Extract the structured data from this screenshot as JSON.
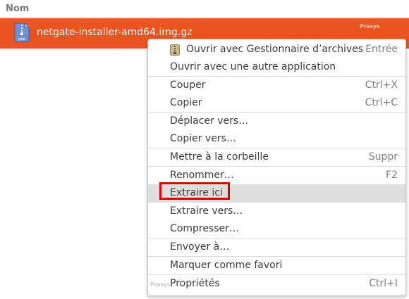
{
  "column_header": {
    "name_label": "Nom"
  },
  "file": {
    "name": "netgate-installer-amd64.img.gz",
    "icon": "gzip-archive-icon",
    "icon_caption": "gzip",
    "selected_color": "#e95420"
  },
  "watermark": "Prasys",
  "context_menu": {
    "items": [
      {
        "label": "Ouvrir avec Gestionnaire d’archives",
        "shortcut": "Entrée",
        "icon": "archive-manager-icon"
      },
      {
        "label": "Ouvrir avec une autre application",
        "shortcut": ""
      },
      {
        "label": "Couper",
        "shortcut": "Ctrl+X"
      },
      {
        "label": "Copier",
        "shortcut": "Ctrl+C"
      },
      {
        "label": "Déplacer vers…",
        "shortcut": ""
      },
      {
        "label": "Copier vers…",
        "shortcut": ""
      },
      {
        "label": "Mettre à la corbeille",
        "shortcut": "Suppr"
      },
      {
        "label": "Renommer…",
        "shortcut": "F2"
      },
      {
        "label": "Extraire ici",
        "shortcut": "",
        "highlighted": true
      },
      {
        "label": "Extraire vers…",
        "shortcut": ""
      },
      {
        "label": "Compresser…",
        "shortcut": ""
      },
      {
        "label": "Envoyer à…",
        "shortcut": ""
      },
      {
        "label": "Marquer comme favori",
        "shortcut": ""
      },
      {
        "label": "Propriétés",
        "shortcut": "Ctrl+I"
      }
    ],
    "highlight_box_color": "#e00000"
  }
}
